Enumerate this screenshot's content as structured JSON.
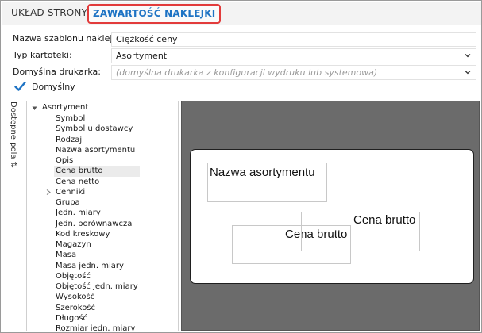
{
  "tabs": {
    "layout": "UKŁAD STRONY",
    "content": "ZAWARTOŚĆ NAKLEJKI"
  },
  "form": {
    "template_name_label": "Nazwa szablonu naklejek:",
    "template_name_value": "Ciężkość ceny",
    "card_type_label": "Typ kartoteki:",
    "card_type_value": "Asortyment",
    "default_printer_label": "Domyślna drukarka:",
    "default_printer_placeholder": "(domyślna drukarka z konfiguracji wydruku lub systemowa)",
    "default_checkbox_label": "Domyślny",
    "default_checked": true
  },
  "side_tab": {
    "label": "Dostępne pola ⇅"
  },
  "tree": {
    "root": "Asortyment",
    "items": [
      "Symbol",
      "Symbol u dostawcy",
      "Rodzaj",
      "Nazwa asortymentu",
      "Opis",
      "Cena brutto",
      "Cena netto",
      "Cenniki",
      "Grupa",
      "Jedn. miary",
      "Jedn. porównawcza",
      "Kod kreskowy",
      "Magazyn",
      "Masa",
      "Masa jedn. miary",
      "Objętość",
      "Objętość jedn. miary",
      "Wysokość",
      "Szerokość",
      "Długość",
      "Rozmiar jedn. miary"
    ],
    "selected": "Cena brutto",
    "expandable": "Cenniki"
  },
  "canvas": {
    "fields": [
      "Nazwa asortymentu",
      "Cena brutto",
      "Cena brutto"
    ]
  },
  "colors": {
    "accent": "#1e73c4",
    "highlight_border": "#e23b3b",
    "canvas_bg": "#6b6b6b",
    "check": "#1e73c4"
  },
  "icons": {
    "dropdown": "chevron-down-icon",
    "check": "checkmark-icon",
    "tree_expanded": "triangle-down-icon",
    "tree_collapsed": "triangle-right-icon"
  }
}
